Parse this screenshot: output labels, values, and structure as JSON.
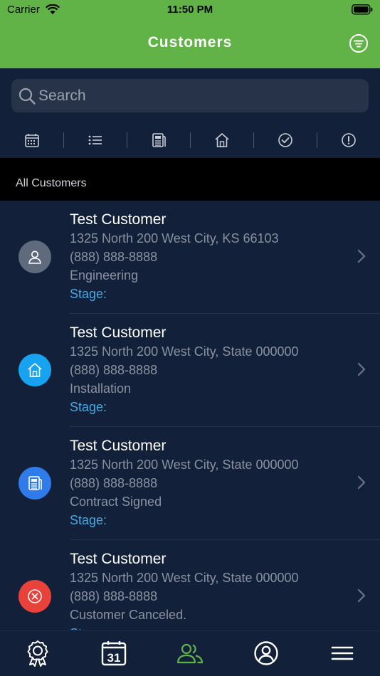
{
  "status": {
    "carrier": "Carrier",
    "time": "11:50 PM"
  },
  "header": {
    "title": "Customers"
  },
  "search": {
    "placeholder": "Search"
  },
  "filters": [
    "calendar-icon",
    "list-icon",
    "contract-icon",
    "home-icon",
    "check-circle-icon",
    "alert-circle-icon"
  ],
  "section": {
    "title": "All Customers"
  },
  "customers": [
    {
      "name": "Test Customer",
      "address": "1325 North 200 West City, KS 66103",
      "phone": "(888) 888-8888",
      "status": "Engineering",
      "stage": "Stage:",
      "icon": "person-icon",
      "color": "#5f6b7c"
    },
    {
      "name": "Test Customer",
      "address": "1325 North 200 West City, State 000000",
      "phone": "(888) 888-8888",
      "status": "Installation",
      "stage": "Stage:",
      "icon": "home-icon",
      "color": "#18a3f0"
    },
    {
      "name": "Test Customer",
      "address": "1325 North 200 West City, State 000000",
      "phone": "(888) 888-8888",
      "status": "Contract Signed",
      "stage": "Stage:",
      "icon": "contract-icon",
      "color": "#2f7be9"
    },
    {
      "name": "Test Customer",
      "address": "1325 North 200 West City, State 000000",
      "phone": "(888) 888-8888",
      "status": "Customer Canceled.",
      "stage": "Stage:",
      "icon": "cancel-icon",
      "color": "#e8423b"
    }
  ],
  "tabbar": {
    "tabs": [
      {
        "icon": "award-icon",
        "active": false
      },
      {
        "icon": "calendar-icon",
        "label": "31",
        "active": false
      },
      {
        "icon": "people-icon",
        "active": true
      },
      {
        "icon": "profile-icon",
        "active": false
      },
      {
        "icon": "menu-icon",
        "active": false
      }
    ]
  },
  "colors": {
    "brand": "#61b347",
    "background": "#12203a",
    "stage": "#4aa8e0"
  }
}
